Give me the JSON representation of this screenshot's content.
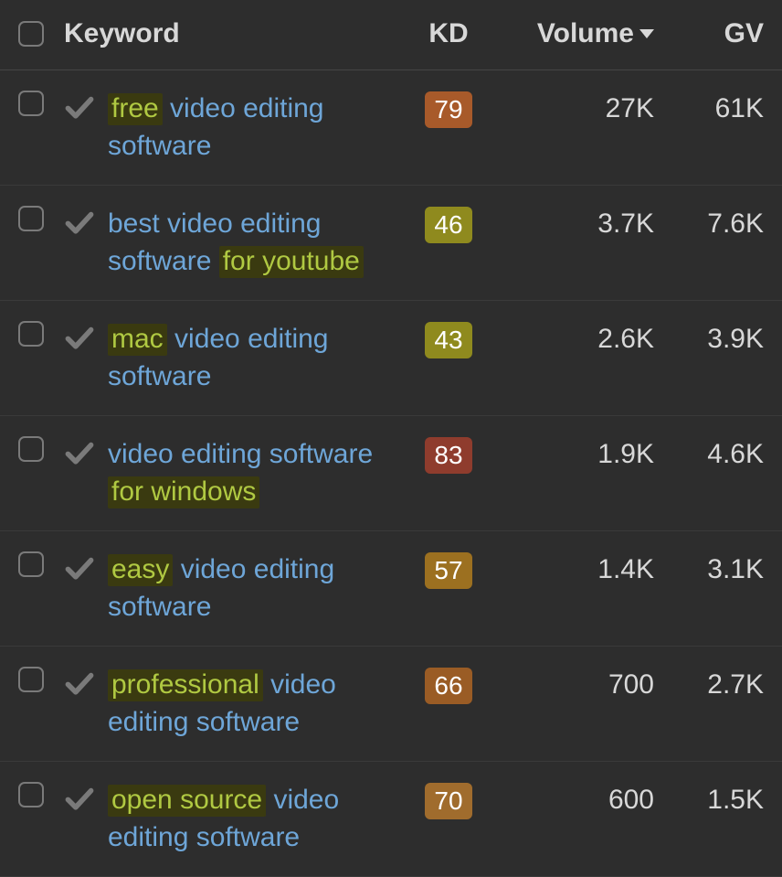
{
  "columns": {
    "keyword": "Keyword",
    "kd": "KD",
    "volume": "Volume",
    "gv": "GV"
  },
  "sort": {
    "column": "volume",
    "dir": "desc"
  },
  "rows": [
    {
      "keyword_parts": [
        {
          "t": "free",
          "hl": true
        },
        {
          "t": " video editing software",
          "hl": false
        }
      ],
      "kd": "79",
      "kd_class": "kd-orange",
      "volume": "27K",
      "gv": "61K"
    },
    {
      "keyword_parts": [
        {
          "t": "best video editing software ",
          "hl": false
        },
        {
          "t": "for youtube",
          "hl": true
        }
      ],
      "kd": "46",
      "kd_class": "kd-olive",
      "volume": "3.7K",
      "gv": "7.6K"
    },
    {
      "keyword_parts": [
        {
          "t": "mac",
          "hl": true
        },
        {
          "t": " video editing software",
          "hl": false
        }
      ],
      "kd": "43",
      "kd_class": "kd-olive",
      "volume": "2.6K",
      "gv": "3.9K"
    },
    {
      "keyword_parts": [
        {
          "t": "video editing software ",
          "hl": false
        },
        {
          "t": "for windows",
          "hl": true
        }
      ],
      "kd": "83",
      "kd_class": "kd-red",
      "volume": "1.9K",
      "gv": "4.6K"
    },
    {
      "keyword_parts": [
        {
          "t": "easy",
          "hl": true
        },
        {
          "t": " video editing software",
          "hl": false
        }
      ],
      "kd": "57",
      "kd_class": "kd-amber",
      "volume": "1.4K",
      "gv": "3.1K"
    },
    {
      "keyword_parts": [
        {
          "t": "professional",
          "hl": true
        },
        {
          "t": " video editing software",
          "hl": false
        }
      ],
      "kd": "66",
      "kd_class": "kd-brown",
      "volume": "700",
      "gv": "2.7K"
    },
    {
      "keyword_parts": [
        {
          "t": "open source",
          "hl": true
        },
        {
          "t": " video editing software",
          "hl": false
        }
      ],
      "kd": "70",
      "kd_class": "kd-tan",
      "volume": "600",
      "gv": "1.5K"
    }
  ]
}
